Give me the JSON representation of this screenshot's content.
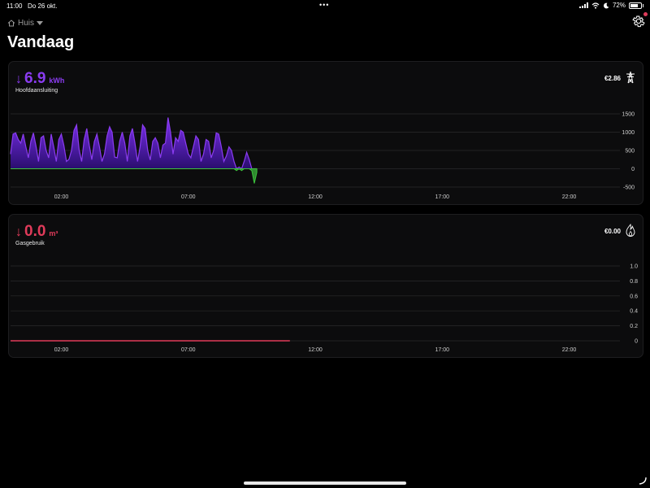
{
  "status": {
    "time": "11:00",
    "date": "Do 26 okt.",
    "battery": "72%",
    "battery_level": 0.72
  },
  "location": {
    "label": "Huis"
  },
  "page": {
    "title": "Vandaag"
  },
  "electricity": {
    "value": "6.9",
    "unit": "kWh",
    "label": "Hoofdaansluiting",
    "cost": "€2.86",
    "color": "#8a3cf0",
    "return_color": "#3cc43c"
  },
  "gas": {
    "value": "0.0",
    "unit": "m³",
    "label": "Gasgebruik",
    "cost": "€0.00",
    "color": "#e03b5a"
  },
  "chart_data": [
    {
      "type": "area",
      "title": "",
      "ylim": [
        -500,
        1500
      ],
      "y_ticks": [
        "1500",
        "1000",
        "500",
        "0",
        "-500"
      ],
      "x_ticks": [
        "02:00",
        "07:00",
        "12:00",
        "17:00",
        "22:00"
      ],
      "xlim_hours": [
        0,
        24
      ],
      "series": [
        {
          "x": [
            0,
            0.1,
            0.2,
            0.3,
            0.4,
            0.5,
            0.6,
            0.7,
            0.8,
            0.9,
            1,
            1.1,
            1.2,
            1.3,
            1.4,
            1.5,
            1.6,
            1.7,
            1.8,
            1.9,
            2,
            2.1,
            2.2,
            2.3,
            2.4,
            2.5,
            2.6,
            2.7,
            2.8,
            2.9,
            3,
            3.1,
            3.2,
            3.3,
            3.4,
            3.5,
            3.6,
            3.7,
            3.8,
            3.9,
            4,
            4.1,
            4.2,
            4.3,
            4.4,
            4.5,
            4.6,
            4.7,
            4.8,
            4.9,
            5,
            5.1,
            5.2,
            5.3,
            5.4,
            5.5,
            5.6,
            5.7,
            5.8,
            5.9,
            6,
            6.1,
            6.2,
            6.3,
            6.4,
            6.5,
            6.6,
            6.7,
            6.8,
            6.9,
            7,
            7.1,
            7.2,
            7.3,
            7.4,
            7.5,
            7.6,
            7.7,
            7.8,
            7.9,
            8,
            8.1,
            8.2,
            8.3,
            8.4,
            8.5,
            8.6,
            8.7,
            8.8,
            8.9,
            9,
            9.1,
            9.2,
            9.3,
            9.4,
            9.5,
            9.6,
            9.7,
            9.8,
            9.9,
            10,
            10.1,
            10.2,
            10.3,
            10.4,
            10.5
          ],
          "values": [
            400,
            950,
            980,
            800,
            700,
            950,
            600,
            300,
            750,
            980,
            620,
            200,
            850,
            900,
            500,
            300,
            950,
            600,
            200,
            800,
            950,
            640,
            200,
            260,
            500,
            1050,
            1200,
            520,
            200,
            800,
            1100,
            640,
            250,
            740,
            950,
            600,
            200,
            400,
            900,
            1150,
            1000,
            320,
            300,
            760,
            1000,
            700,
            200,
            900,
            1100,
            700,
            200,
            600,
            1200,
            1100,
            500,
            240,
            750,
            850,
            700,
            300,
            650,
            700,
            1400,
            1000,
            400,
            850,
            750,
            1050,
            1000,
            700,
            400,
            300,
            600,
            900,
            800,
            200,
            400,
            800,
            750,
            300,
            500,
            980,
            950,
            600,
            200,
            350,
            600,
            500,
            200,
            -50,
            50,
            -50,
            200,
            450,
            250,
            -50,
            -400,
            -100,
            null,
            null,
            null,
            null,
            null,
            null,
            null,
            null
          ]
        }
      ]
    },
    {
      "type": "line",
      "title": "",
      "ylim": [
        0,
        1.0
      ],
      "y_ticks": [
        "1.0",
        "0.8",
        "0.6",
        "0.4",
        "0.2",
        "0"
      ],
      "x_ticks": [
        "02:00",
        "07:00",
        "12:00",
        "17:00",
        "22:00"
      ],
      "series": [
        {
          "x": [
            0,
            11
          ],
          "values": [
            0,
            0
          ]
        }
      ]
    }
  ]
}
